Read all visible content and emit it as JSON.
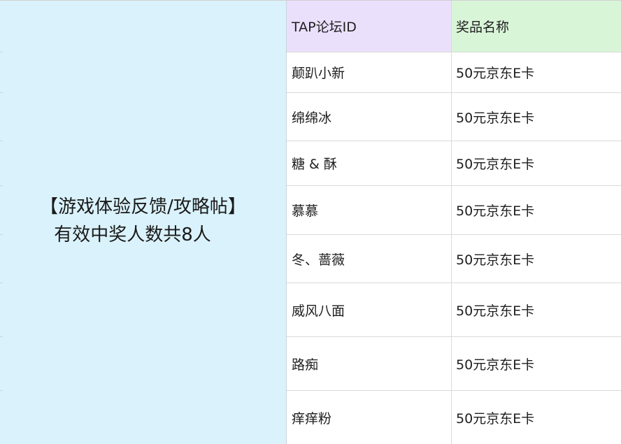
{
  "announcement": {
    "line1": "【游戏体验反馈/攻略帖】",
    "line2": "有效中奖人数共8人"
  },
  "table": {
    "headers": [
      "TAP论坛ID",
      "奖品名称"
    ],
    "rows": [
      {
        "id": "颠趴小新",
        "prize": "50元京东E卡"
      },
      {
        "id": "绵绵冰",
        "prize": "50元京东E卡"
      },
      {
        "id": "糖 & 酥",
        "prize": "50元京东E卡"
      },
      {
        "id": "慕慕",
        "prize": "50元京东E卡"
      },
      {
        "id": "冬、蔷薇",
        "prize": "50元京东E卡"
      },
      {
        "id": "威风八面",
        "prize": "50元京东E卡"
      },
      {
        "id": "路痴",
        "prize": "50元京东E卡"
      },
      {
        "id": "痒痒粉",
        "prize": "50元京东E卡"
      }
    ]
  },
  "colors": {
    "left_panel_bg": "#daf2fb",
    "header_id_bg": "#ebe0fc",
    "header_prize_bg": "#d9f5d8"
  }
}
